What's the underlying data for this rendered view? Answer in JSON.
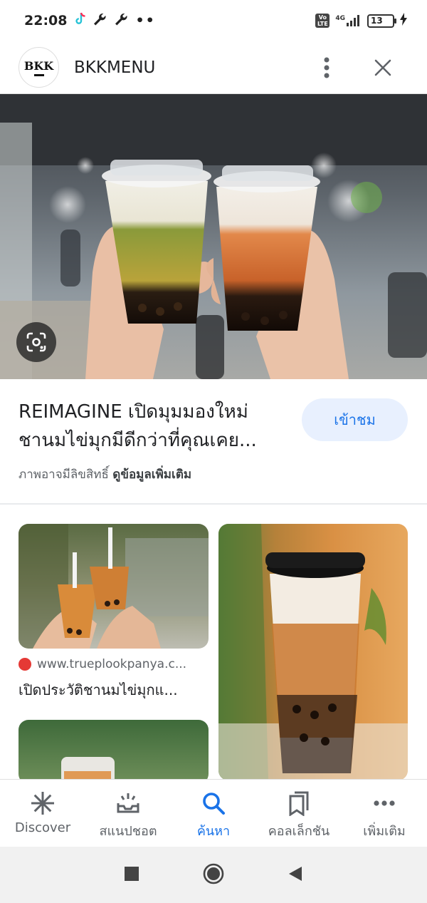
{
  "status_bar": {
    "time": "22:08",
    "network": "4G",
    "volte": "Vo LTE",
    "battery": "13"
  },
  "header": {
    "logo_text": "BKK",
    "site_name": "BKKMENU"
  },
  "hero": {
    "lens_icon": "google-lens-icon"
  },
  "result": {
    "title_line1": "REIMAGINE เปิดมุมมองใหม่",
    "title_line2": "ชานมไข่มุกมีดีกว่าที่คุณเคย...",
    "visit_label": "เข้าชม",
    "copyright_text": "ภาพอาจมีลิขสิทธิ์",
    "more_info_label": "ดูข้อมูลเพิ่มเติม"
  },
  "related": {
    "source": "www.trueplookpanya.c...",
    "title": "เปิดประวัติชานมไข่มุกแ..."
  },
  "bottom_nav": {
    "items": [
      {
        "label": "Discover",
        "icon": "asterisk-icon"
      },
      {
        "label": "สแนปชอต",
        "icon": "snapshot-icon"
      },
      {
        "label": "ค้นหา",
        "icon": "search-icon"
      },
      {
        "label": "คอลเล็กชัน",
        "icon": "bookmarks-icon"
      },
      {
        "label": "เพิ่มเติม",
        "icon": "more-dots-icon"
      }
    ],
    "active": "ค้นหา"
  },
  "colors": {
    "accent": "#1a73e8",
    "visit_bg": "#e8f0fe"
  }
}
